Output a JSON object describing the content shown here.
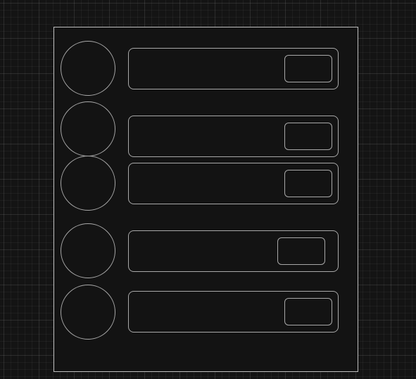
{
  "colors": {
    "background": "#141414",
    "frame_fill": "#131313",
    "frame_stroke": "#bdbdbd",
    "shape_stroke": "#a8a8a8"
  },
  "diagram": {
    "rows": [
      {
        "circle": "circle-node-1",
        "bar": "bar-1",
        "button": "bar-button-1"
      },
      {
        "circle": "circle-node-2",
        "bar": "bar-2",
        "button": "bar-button-2"
      },
      {
        "circle": "circle-node-3",
        "bar": "bar-3",
        "button": "bar-button-3"
      },
      {
        "circle": "circle-node-4",
        "bar": "bar-4",
        "button": "bar-button-4"
      },
      {
        "circle": "circle-node-5",
        "bar": "bar-5",
        "button": "bar-button-5"
      }
    ]
  }
}
